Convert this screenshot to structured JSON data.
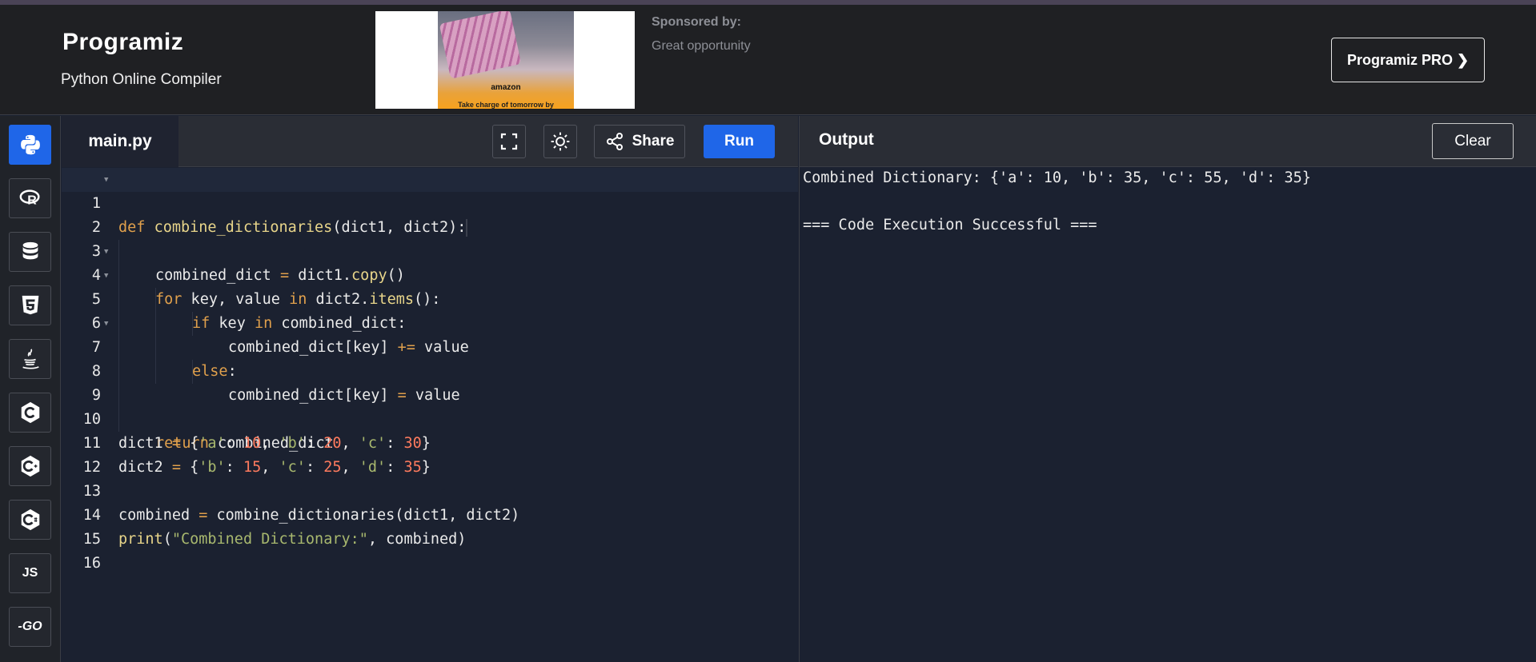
{
  "header": {
    "logo": "Programiz",
    "subtitle": "Python Online Compiler",
    "ad": {
      "brand": "amazon",
      "tagline": "Take charge of tomorrow by"
    },
    "sponsor_label": "Sponsored by:",
    "sponsor_text": "Great opportunity",
    "pro_button": "Programiz PRO ❯"
  },
  "sidebar": {
    "items": [
      {
        "name": "python",
        "icon": "python-icon",
        "active": true
      },
      {
        "name": "r",
        "icon": "r-icon"
      },
      {
        "name": "sql",
        "icon": "database-icon"
      },
      {
        "name": "html",
        "icon": "html5-icon"
      },
      {
        "name": "java",
        "icon": "java-icon"
      },
      {
        "name": "c",
        "icon": "c-icon"
      },
      {
        "name": "cpp",
        "icon": "cpp-icon"
      },
      {
        "name": "csharp",
        "icon": "csharp-icon"
      },
      {
        "name": "js",
        "label": "JS"
      },
      {
        "name": "go",
        "label": "-GO"
      }
    ]
  },
  "editor": {
    "tab": "main.py",
    "share_label": "Share",
    "run_label": "Run",
    "lines": [
      "1",
      "2",
      "3",
      "4",
      "5",
      "6",
      "7",
      "8",
      "9",
      "10",
      "11",
      "12",
      "13",
      "14",
      "15",
      "16"
    ]
  },
  "output": {
    "title": "Output",
    "clear_label": "Clear",
    "lines": [
      "Combined Dictionary: {'a': 10, 'b': 35, 'c': 55, 'd': 35}",
      "",
      "=== Code Execution Successful ==="
    ]
  },
  "code": {
    "l1": {
      "kw": "def",
      "name": "combine_dictionaries",
      "args": "(dict1, dict2):"
    },
    "l2": {
      "a": "combined_dict ",
      "op": "=",
      "b": " dict1.",
      "fn": "copy",
      "c": "()"
    },
    "l3": {
      "kw1": "for",
      "a": " key, value ",
      "kw2": "in",
      "b": " dict2.",
      "fn": "items",
      "c": "():"
    },
    "l4": {
      "kw1": "if",
      "a": " key ",
      "kw2": "in",
      "b": " combined_dict:"
    },
    "l5": {
      "a": "combined_dict[key] ",
      "op": "+=",
      "b": " value"
    },
    "l6": {
      "kw": "else",
      "a": ":"
    },
    "l7": {
      "a": "combined_dict[key] ",
      "op": "=",
      "b": " value"
    },
    "l9": {
      "kw": "return",
      "a": " combined_dict"
    },
    "l10": {
      "a": "dict1 ",
      "op": "=",
      "b": " {",
      "k1": "'a'",
      "c1": ": ",
      "v1": "10",
      "d1": ", ",
      "k2": "'b'",
      "c2": ": ",
      "v2": "20",
      "d2": ", ",
      "k3": "'c'",
      "c3": ": ",
      "v3": "30",
      "e": "}"
    },
    "l11": {
      "a": "dict2 ",
      "op": "=",
      "b": " {",
      "k1": "'b'",
      "c1": ": ",
      "v1": "15",
      "d1": ", ",
      "k2": "'c'",
      "c2": ": ",
      "v2": "25",
      "d2": ", ",
      "k3": "'d'",
      "c3": ": ",
      "v3": "35",
      "e": "}"
    },
    "l13": {
      "a": "combined ",
      "op": "=",
      "b": " combine_dictionaries(dict1, dict2)"
    },
    "l14": {
      "fn": "print",
      "a": "(",
      "str": "\"Combined Dictionary:\"",
      "b": ", combined)"
    }
  }
}
